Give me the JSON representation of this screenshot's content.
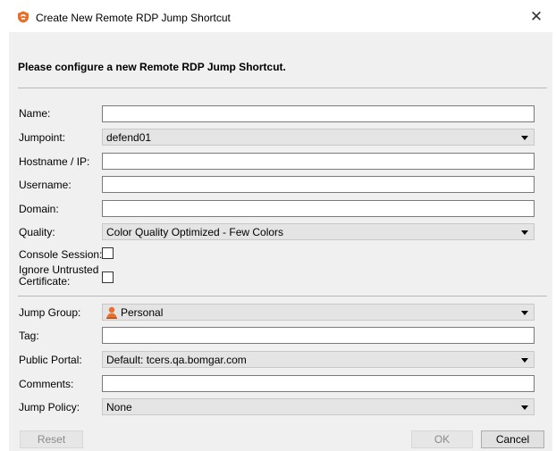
{
  "window": {
    "title": "Create New Remote RDP Jump Shortcut",
    "close_glyph": "✕"
  },
  "heading": "Please configure a new Remote RDP Jump Shortcut.",
  "fields": {
    "name": {
      "label": "Name:",
      "value": ""
    },
    "jumpoint": {
      "label": "Jumpoint:",
      "value": "defend01"
    },
    "hostname": {
      "label": "Hostname / IP:",
      "value": ""
    },
    "username": {
      "label": "Username:",
      "value": ""
    },
    "domain": {
      "label": "Domain:",
      "value": ""
    },
    "quality": {
      "label": "Quality:",
      "value": "Color Quality Optimized - Few Colors"
    },
    "console_session": {
      "label": "Console Session:",
      "checked": false
    },
    "ignore_cert": {
      "label_line1": "Ignore Untrusted",
      "label_line2": "Certificate:",
      "checked": false
    },
    "jump_group": {
      "label": "Jump Group:",
      "value": "Personal",
      "icon": "person-icon"
    },
    "tag": {
      "label": "Tag:",
      "value": ""
    },
    "public_portal": {
      "label": "Public Portal:",
      "value": "Default: tcers.qa.bomgar.com"
    },
    "comments": {
      "label": "Comments:",
      "value": ""
    },
    "jump_policy": {
      "label": "Jump Policy:",
      "value": "None"
    }
  },
  "buttons": {
    "reset": "Reset",
    "ok": "OK",
    "cancel": "Cancel"
  },
  "colors": {
    "panel_bg": "#f0f0f0",
    "select_bg": "#e4e4e4",
    "app_icon": "#e8702a",
    "person_icon": "#e8702a"
  }
}
